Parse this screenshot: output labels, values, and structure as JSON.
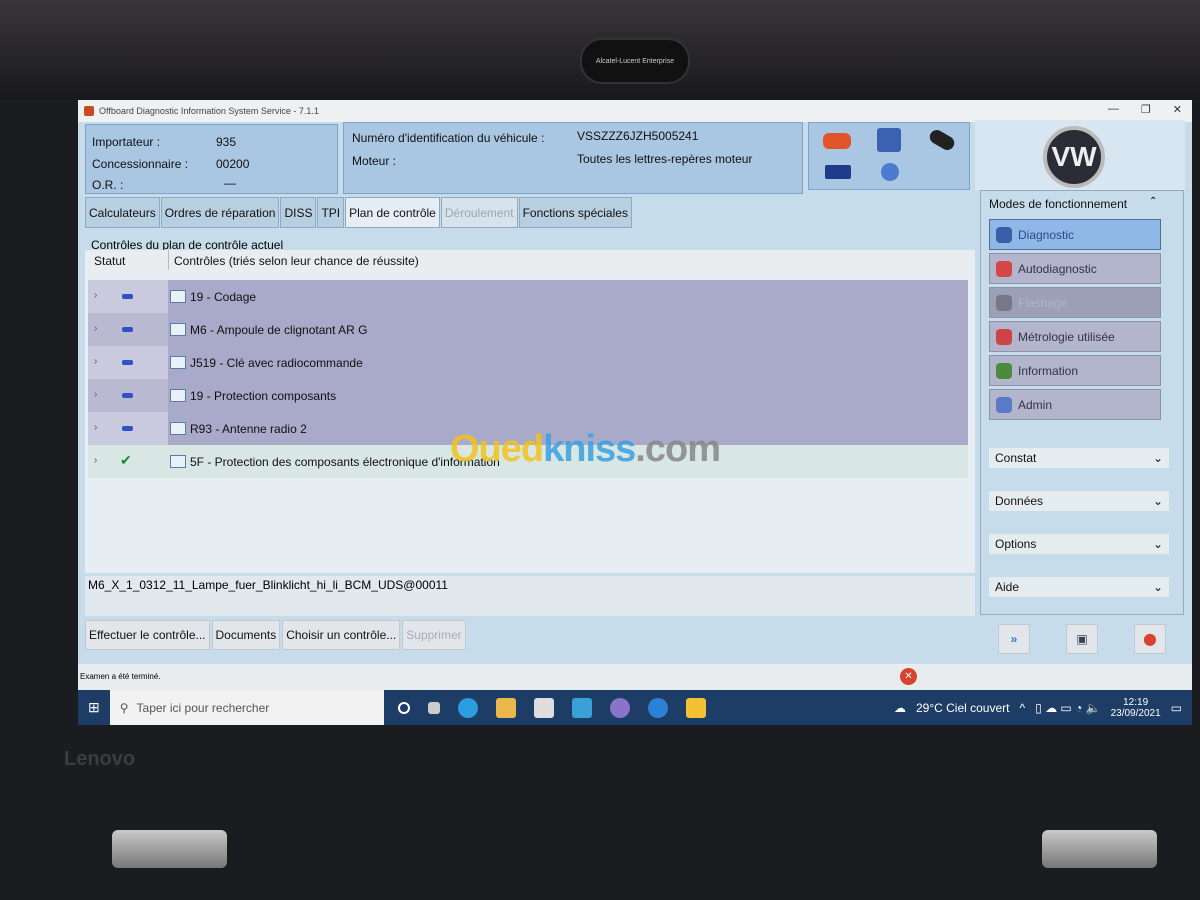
{
  "window": {
    "title": "Offboard Diagnostic Information System Service - 7.1.1",
    "controls": [
      "—",
      "❐",
      "✕"
    ]
  },
  "camera_logo": "Alcatel-Lucent Enterprise",
  "header": {
    "importateur_label": "Importateur :",
    "importateur": "935",
    "concessionnaire_label": "Concessionnaire :",
    "concessionnaire": "00200",
    "or_label": "O.R. :",
    "or": "—",
    "vin_label": "Numéro d'identification du véhicule :",
    "vin": "VSSZZZ6JZH5005241",
    "moteur_label": "Moteur :",
    "moteur": "Toutes les lettres-repères moteur",
    "icons": [
      "car-icon",
      "network-icon",
      "key-icon",
      "usb-icon",
      "info-icon"
    ],
    "brand_logo": "VW"
  },
  "tabs": [
    {
      "label": "Calculateurs",
      "state": "normal"
    },
    {
      "label": "Ordres de réparation",
      "state": "normal"
    },
    {
      "label": "DISS",
      "state": "normal"
    },
    {
      "label": "TPI",
      "state": "normal"
    },
    {
      "label": "Plan de contrôle",
      "state": "active"
    },
    {
      "label": "Déroulement",
      "state": "disabled"
    },
    {
      "label": "Fonctions spéciales",
      "state": "normal"
    }
  ],
  "main": {
    "section_title": "Contrôles du plan de contrôle actuel",
    "columns": [
      "Statut",
      "Contrôles (triés selon leur chance de réussite)"
    ],
    "rows": [
      {
        "status": "pending",
        "label": "19 - Codage"
      },
      {
        "status": "pending",
        "label": "M6 - Ampoule de clignotant AR G"
      },
      {
        "status": "pending",
        "label": "J519 - Clé avec radiocommande"
      },
      {
        "status": "pending",
        "label": "19 - Protection composants"
      },
      {
        "status": "pending",
        "label": "R93 - Antenne radio 2"
      },
      {
        "status": "done",
        "label": "5F - Protection des composants électronique d'information"
      }
    ],
    "detail_text": "M6_X_1_0312_11_Lampe_fuer_Blinklicht_hi_li_BCM_UDS@00011",
    "buttons": [
      {
        "label": "Effectuer le contrôle...",
        "enabled": true
      },
      {
        "label": "Documents",
        "enabled": true
      },
      {
        "label": "Choisir un contrôle...",
        "enabled": true
      },
      {
        "label": "Supprimer",
        "enabled": false
      }
    ],
    "status_text": "Examen a été terminé."
  },
  "sidebar": {
    "title": "Modes de fonctionnement",
    "modes": [
      {
        "label": "Diagnostic",
        "state": "active",
        "icon": "stethoscope-icon"
      },
      {
        "label": "Autodiagnostic",
        "state": "normal",
        "icon": "autodiag-icon"
      },
      {
        "label": "Flashage",
        "state": "disabled",
        "icon": "flash-icon"
      },
      {
        "label": "Métrologie utilisée",
        "state": "normal",
        "icon": "gauge-icon"
      },
      {
        "label": "Information",
        "state": "normal",
        "icon": "books-icon"
      },
      {
        "label": "Admin",
        "state": "normal",
        "icon": "gear-icon"
      }
    ],
    "sections": [
      "Constat",
      "Données",
      "Options",
      "Aide"
    ],
    "bottom_buttons": [
      "forward-icon",
      "fullscreen-icon",
      "close-icon"
    ]
  },
  "taskbar": {
    "search_placeholder": "Taper ici pour rechercher",
    "weather": "29°C  Ciel couvert",
    "time": "12:19",
    "date": "23/09/2021"
  },
  "watermark": "Ouedkniss.com",
  "laptop_logo": "Lenovo",
  "colors": {
    "accent": "#2f52c8",
    "ok": "#1c8a2a",
    "row_pending": "#a9aac9",
    "row_done": "#d8e6e4"
  }
}
